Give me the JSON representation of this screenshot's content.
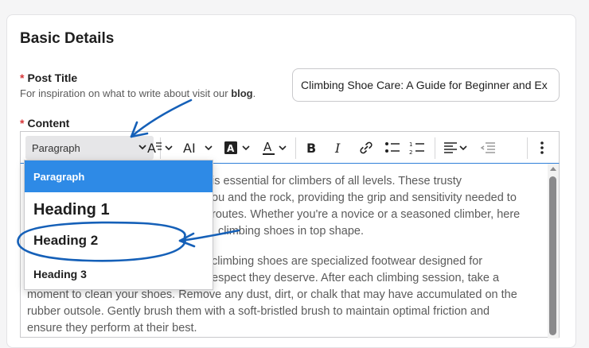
{
  "section": {
    "title": "Basic Details"
  },
  "post_title": {
    "required_mark": "*",
    "label": "Post Title",
    "help_prefix": "For inspiration on what to write about visit our ",
    "help_link": "blog",
    "help_suffix": ".",
    "value": "Climbing Shoe Care: A Guide for Beginner and Ex"
  },
  "content": {
    "required_mark": "*",
    "label": "Content"
  },
  "toolbar": {
    "block_format": "Paragraph",
    "icons": [
      "font-size-icon",
      "line-height-icon",
      "highlight-color-icon",
      "text-color-icon",
      "bold-icon",
      "italic-icon",
      "link-icon",
      "bullet-list-icon",
      "numbered-list-icon",
      "align-left-icon",
      "outdent-icon",
      "more-options-icon"
    ]
  },
  "dropdown": {
    "options": [
      "Paragraph",
      "Heading 1",
      "Heading 2",
      "Heading 3"
    ],
    "selected": "Paragraph"
  },
  "editor": {
    "lines": [
      "is essential for climbers of all levels. These trusty",
      "ou and the rock, providing the grip and sensitivity needed to",
      "routes. Whether you're a novice or a seasoned climber, here",
      "climbing shoes in top shape.",
      "climbing shoes are specialized footwear designed for",
      "espect they deserve. After each climbing session, take a",
      "moment to clean your shoes. Remove any dust, dirt, or chalk that may have accumulated on the",
      "rubber outsole. Gently brush them with a soft-bristled brush to maintain optimal friction and",
      "ensure they perform at their best."
    ]
  },
  "colors": {
    "accent": "#2e8ae6",
    "annotation": "#1560b8",
    "required": "#d63638"
  }
}
